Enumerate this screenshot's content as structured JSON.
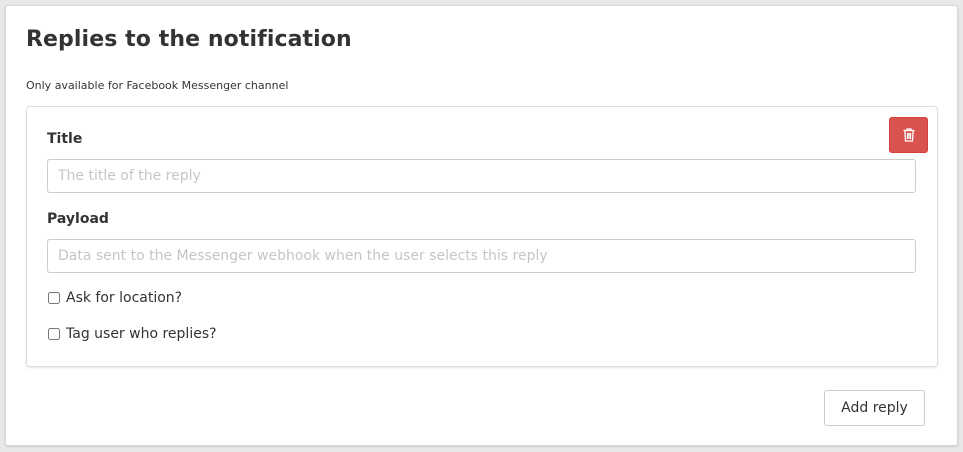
{
  "panel": {
    "title": "Replies to the notification",
    "subtitle": "Only available for Facebook Messenger channel"
  },
  "reply": {
    "title_label": "Title",
    "title_placeholder": "The title of the reply",
    "title_value": "",
    "payload_label": "Payload",
    "payload_placeholder": "Data sent to the Messenger webhook when the user selects this reply",
    "payload_value": "",
    "ask_location_label": "Ask for location?",
    "ask_location_checked": false,
    "tag_user_label": "Tag user who replies?",
    "tag_user_checked": false,
    "delete_icon": "trash-icon"
  },
  "actions": {
    "add_reply_label": "Add reply"
  },
  "colors": {
    "danger": "#d9534f",
    "text": "#333333",
    "placeholder": "#c6c6c6",
    "border": "#cccccc"
  }
}
